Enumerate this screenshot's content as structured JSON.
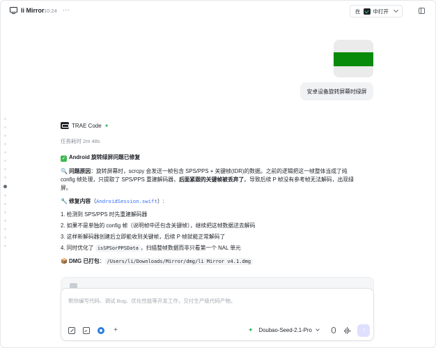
{
  "titlebar": {
    "title": "li Mirror",
    "time": "10:24",
    "more": "···",
    "open_in_prefix": "在",
    "open_in_suffix": "中打开"
  },
  "conversation": {
    "user_message": "安卓设备旋转屏幕时绿屏",
    "bot_name": "TRAE Code",
    "elapsed": "任务耗时 2m 48s",
    "title": "Android 旋转绿屏问题已修复",
    "cause_label": "问题原因",
    "cause_line1": "：旋转屏幕时，scrcpy 会发送一帧包含 SPS/PPS + 关键帧(IDR)的数据。之前的逻辑把这一帧整体当成了纯",
    "cause_line2_a": "config 帧处理，只提取了 SPS/PPS 重建解码器，",
    "cause_line2_b": "后面紧跟的关键帧被丢弃了",
    "cause_line2_c": "。导致后续 P 帧没有参考帧无法解码，出现绿",
    "cause_line3": "屏。",
    "fix_label": "修复内容",
    "fix_paren_open": "（",
    "fix_file": "AndroidSession.swift",
    "fix_paren_close": "）:",
    "fix_items": [
      "1. 检测到 SPS/PPS 时先重建解码器",
      "2. 如果不是单独的 config 帧（说明帧中还包含关键帧），继续把这帧数据送去解码",
      "3. 这样新解码器创建后立即能收到关键帧，后续 P 帧就能正常解码了"
    ],
    "fix_item4_a": "4. 同时优化了 ",
    "fix_item4_code": "isSPSorPPSData",
    "fix_item4_b": "，扫描整帧数据而非只看第一个 NAL 单元",
    "dmg_label": "DMG 已打包",
    "dmg_sep": "：",
    "dmg_path": "/Users/li/Downloads/Mirror/dmg/li Mirror v4.1.dmg"
  },
  "composer": {
    "placeholder": "帮你编写代码、调试 Bug、优化性能等开发工作，交付生产级代码产物。",
    "model": "Doubao-Seed-2.1-Pro",
    "plus": "+",
    "send": "↑"
  },
  "icons": {
    "window": "window-icon",
    "spark": "spark-icon",
    "wrench": "wrench-icon",
    "magnifier": "magnifier-icon",
    "package": "package-icon",
    "check": "check-icon"
  },
  "colors": {
    "accent_green": "#32b864",
    "check_green": "#3fb950",
    "link_blue": "#3370ff",
    "image_green": "#0a8a0a",
    "send_bg": "#dfe0ff"
  }
}
